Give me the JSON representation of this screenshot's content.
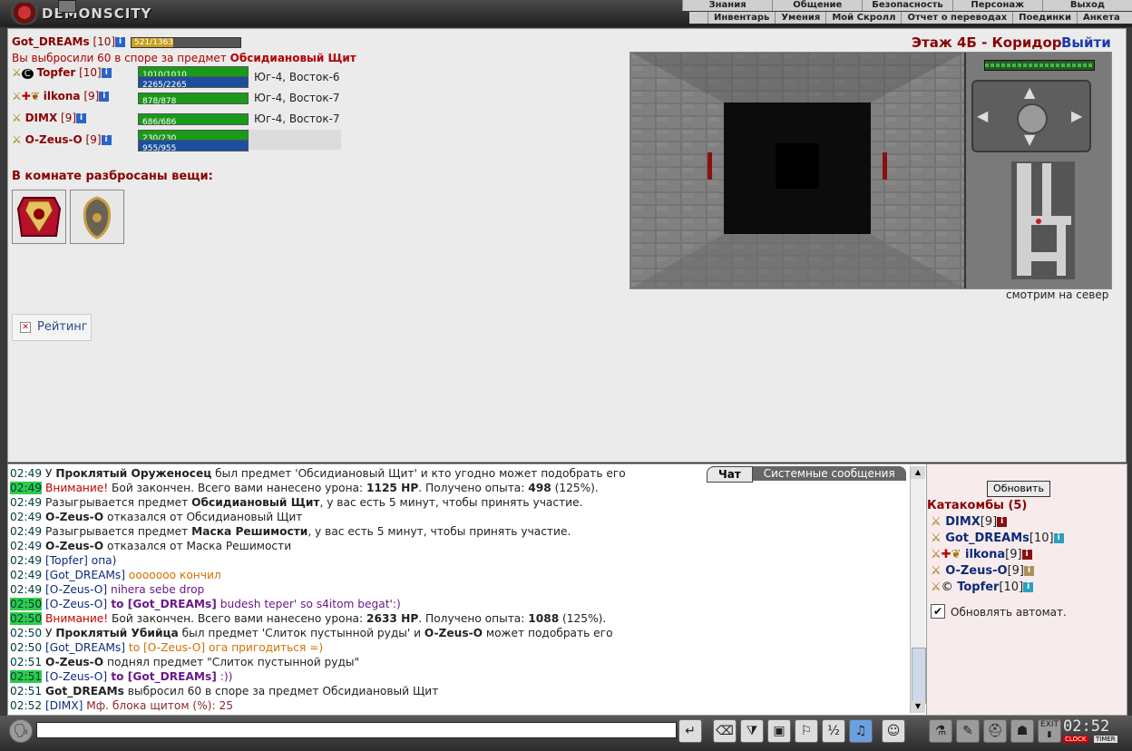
{
  "app": {
    "logo_text": "DEMONSCITY"
  },
  "menu_top": [
    "Знания",
    "Общение",
    "Безопасность",
    "Персонаж",
    "Выход"
  ],
  "menu_sub": [
    "Инвентарь",
    "Умения",
    "Мой Скролл",
    "Отчет о переводах",
    "Поединки",
    "Анкета"
  ],
  "player": {
    "name": "Got_DREAMs",
    "level": "[10]",
    "hp_text": "521/1363",
    "hp_fraction": 0.38
  },
  "message": {
    "prefix": "Вы выбросили 60 в споре за предмет",
    "item": "Обсидиановый Щит"
  },
  "location": {
    "title": "Этаж 4Б - Коридор",
    "exit_label": "Выйти",
    "facing": "смотрим на север"
  },
  "party": [
    {
      "name": "Topfer",
      "level": "[10]",
      "hp": "1010/1010",
      "mp": "2265/2265",
      "coords": "Юг-4, Восток-6"
    },
    {
      "name": "ilkona",
      "level": "[9]",
      "hp": "878/878",
      "mp": "",
      "coords": "Юг-4, Восток-7"
    },
    {
      "name": "DIMX",
      "level": "[9]",
      "hp": "686/686",
      "mp": "",
      "coords": "Юг-4, Восток-7"
    },
    {
      "name": "O-Zeus-O",
      "level": "[9]",
      "hp": "230/230",
      "mp": "955/955",
      "coords": ""
    }
  ],
  "room_items_title": "В комнате разбросаны вещи:",
  "room_items": [
    "armor-item",
    "shield-item"
  ],
  "rating_label": "Рейтинг",
  "chat_tabs": {
    "chat": "Чат",
    "system": "Системные сообщения"
  },
  "chat": [
    {
      "time": "02:49",
      "hl": false,
      "parts": [
        [
          "",
          "У "
        ],
        [
          "b",
          "Проклятый Оруженосец"
        ],
        [
          "",
          " был предмет 'Обсидиановый Щит' и кто угодно может подобрать его"
        ]
      ]
    },
    {
      "time": "02:49",
      "hl": true,
      "parts": [
        [
          "warn",
          "Внимание!"
        ],
        [
          "",
          " Бой закончен. Всего вами нанесено урона: "
        ],
        [
          "b",
          "1125 HP"
        ],
        [
          "",
          ". Получено опыта: "
        ],
        [
          "b",
          "498"
        ],
        [
          "",
          " (125%)."
        ]
      ]
    },
    {
      "time": "02:49",
      "hl": false,
      "parts": [
        [
          "",
          "Разыгрывается предмет "
        ],
        [
          "b",
          "Обсидиановый Щит"
        ],
        [
          "",
          ", у вас есть 5 минут, чтобы принять участие."
        ]
      ]
    },
    {
      "time": "02:49",
      "hl": false,
      "parts": [
        [
          "b",
          "O-Zeus-O"
        ],
        [
          "",
          " отказался от Обсидиановый Щит"
        ]
      ]
    },
    {
      "time": "02:49",
      "hl": false,
      "parts": [
        [
          "",
          "Разыгрывается предмет "
        ],
        [
          "b",
          "Маска Решимости"
        ],
        [
          "",
          ", у вас есть 5 минут, чтобы принять участие."
        ]
      ]
    },
    {
      "time": "02:49",
      "hl": false,
      "parts": [
        [
          "b",
          "O-Zeus-O"
        ],
        [
          "",
          " отказался от Маска Решимости"
        ]
      ]
    },
    {
      "time": "02:49",
      "hl": false,
      "parts": [
        [
          "nm",
          "[Topfer]"
        ],
        [
          "nm",
          " опа)"
        ]
      ]
    },
    {
      "time": "02:49",
      "hl": false,
      "parts": [
        [
          "nm",
          "[Got_DREAMs]"
        ],
        [
          "orange",
          " ооооооо кончил"
        ]
      ]
    },
    {
      "time": "02:49",
      "hl": false,
      "parts": [
        [
          "nm",
          "[O-Zeus-O]"
        ],
        [
          "purple",
          " nihera sebe drop"
        ]
      ]
    },
    {
      "time": "02:50",
      "hl": true,
      "parts": [
        [
          "nm",
          "[O-Zeus-O]"
        ],
        [
          "purpleb",
          " to [Got_DREAMs]"
        ],
        [
          "purple",
          " budesh teper' so s4itom begat':)"
        ]
      ]
    },
    {
      "time": "02:50",
      "hl": true,
      "parts": [
        [
          "warn",
          "Внимание!"
        ],
        [
          "",
          " Бой закончен. Всего вами нанесено урона: "
        ],
        [
          "b",
          "2633 HP"
        ],
        [
          "",
          ". Получено опыта: "
        ],
        [
          "b",
          "1088"
        ],
        [
          "",
          " (125%)."
        ]
      ]
    },
    {
      "time": "02:50",
      "hl": false,
      "parts": [
        [
          "",
          "У "
        ],
        [
          "b",
          "Проклятый Убийца"
        ],
        [
          "",
          " был предмет 'Слиток пустынной руды' и "
        ],
        [
          "b",
          "O-Zeus-O"
        ],
        [
          "",
          " может подобрать его"
        ]
      ]
    },
    {
      "time": "02:50",
      "hl": false,
      "parts": [
        [
          "nm",
          "[Got_DREAMs]"
        ],
        [
          "orange",
          " to [O-Zeus-O] ога пригодиться =)"
        ]
      ]
    },
    {
      "time": "02:51",
      "hl": false,
      "parts": [
        [
          "b",
          "O-Zeus-O"
        ],
        [
          "",
          " поднял предмет \"Слиток пустынной руды\""
        ]
      ]
    },
    {
      "time": "02:51",
      "hl": true,
      "parts": [
        [
          "nm",
          "[O-Zeus-O]"
        ],
        [
          "purpleb",
          " to [Got_DREAMs]"
        ],
        [
          "purple",
          " :))"
        ]
      ]
    },
    {
      "time": "02:51",
      "hl": false,
      "parts": [
        [
          "b",
          "Got_DREAMs"
        ],
        [
          "",
          " выбросил 60 в споре за предмет Обсидиановый Щит"
        ]
      ]
    },
    {
      "time": "02:52",
      "hl": false,
      "parts": [
        [
          "nm",
          "[DIMX]"
        ],
        [
          "brown",
          " Мф. блока щитом (%): 25"
        ]
      ]
    }
  ],
  "side": {
    "refresh_label": "Обновить",
    "room_title": "Катакомбы (5)",
    "players": [
      {
        "name": "DIMX",
        "level": "[9]"
      },
      {
        "name": "Got_DREAMs",
        "level": "[10]"
      },
      {
        "name": "ilkona",
        "level": "[9]"
      },
      {
        "name": "O-Zeus-O",
        "level": "[9]"
      },
      {
        "name": "Topfer",
        "level": "[10]"
      }
    ],
    "auto_refresh_label": "Обновлять автомат.",
    "auto_refresh_checked": true
  },
  "clock": {
    "time": "02:52",
    "clock_label": "CLOCK",
    "timer_label": "TIMER",
    "exit_label": "EXIT"
  }
}
